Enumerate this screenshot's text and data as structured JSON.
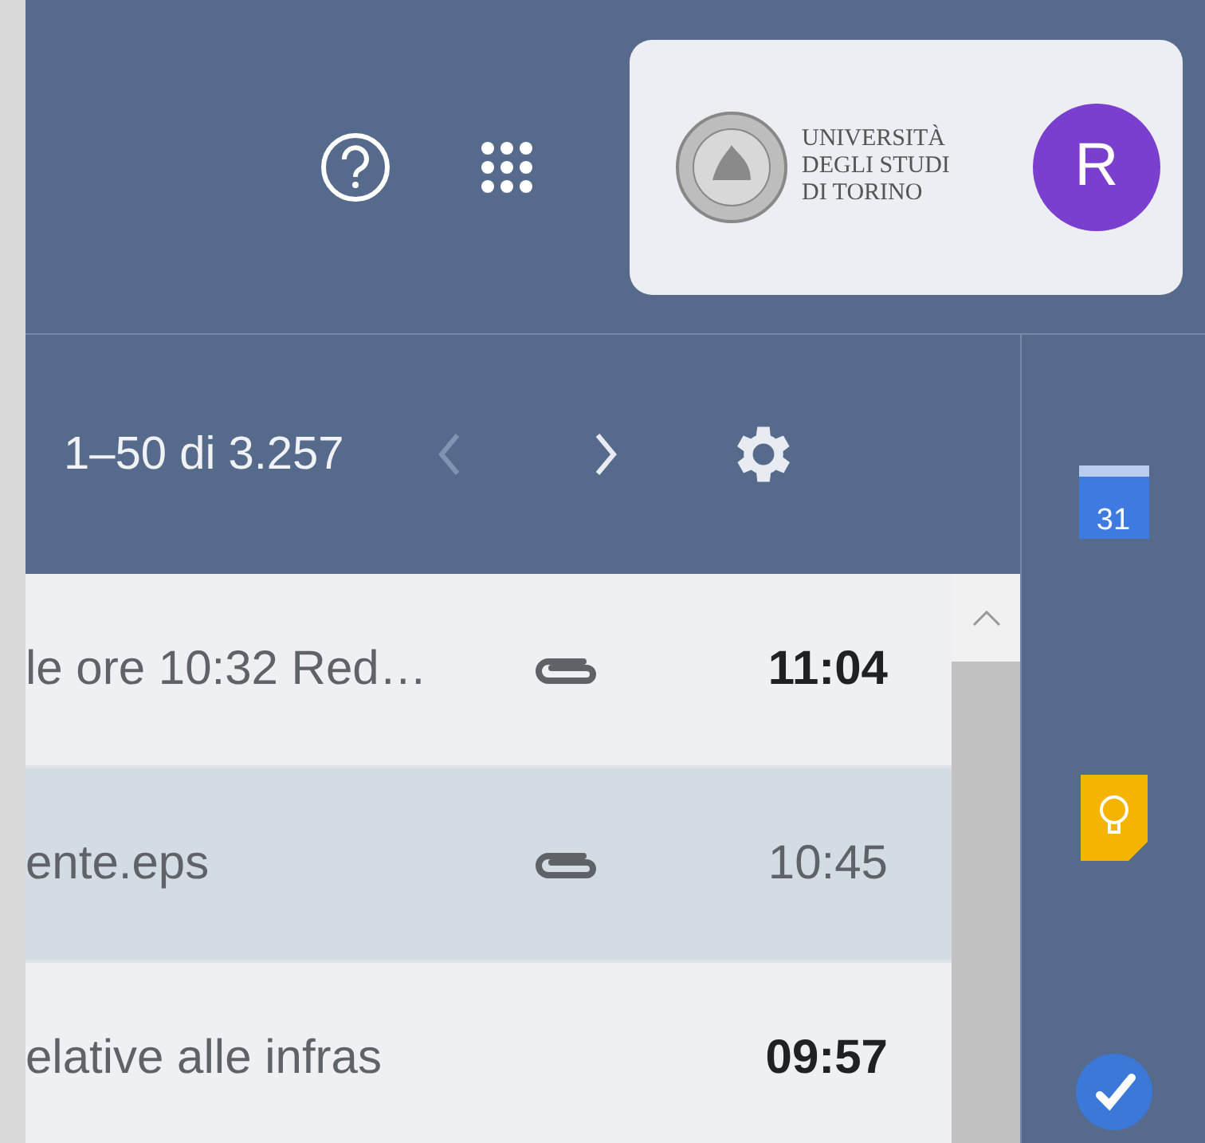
{
  "header": {
    "account": {
      "university_logo_lines": [
        "UNIVERSITÀ",
        "DEGLI STUDI",
        "DI TORINO"
      ],
      "avatar_letter": "R"
    }
  },
  "toolbar": {
    "page_count": "1–50 di 3.257",
    "prev_disabled": true,
    "next_disabled": false
  },
  "messages": [
    {
      "snippet": "le ore 10:32 Red…",
      "has_attachment": true,
      "time": "11:04",
      "unread": true
    },
    {
      "snippet": "ente.eps",
      "has_attachment": true,
      "time": "10:45",
      "unread": false
    },
    {
      "snippet": "elative alle infras",
      "has_attachment": false,
      "time": "09:57",
      "unread": true
    }
  ],
  "side_panel": {
    "calendar_day": "31"
  }
}
